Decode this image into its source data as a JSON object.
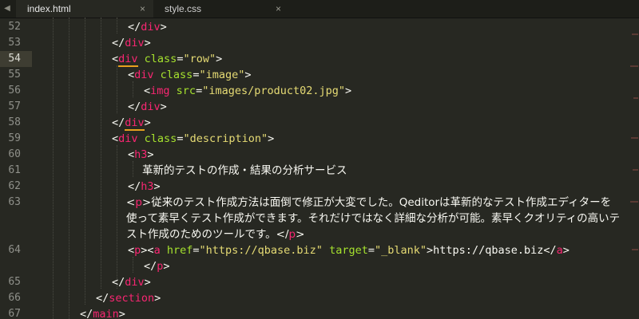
{
  "tabs": [
    {
      "label": "index.html",
      "close": "×"
    },
    {
      "label": "style.css",
      "close": "×"
    }
  ],
  "nav_arrow": "◀",
  "line_numbers": [
    "52",
    "53",
    "54",
    "55",
    "56",
    "57",
    "58",
    "59",
    "60",
    "61",
    "62",
    "63",
    "64",
    "65",
    "66",
    "67"
  ],
  "active_line": "54",
  "code": {
    "l52": {
      "open": "</",
      "tag": "div",
      "close": ">"
    },
    "l53": {
      "open": "</",
      "tag": "div",
      "close": ">"
    },
    "l54": {
      "open": "<",
      "tag": "div",
      "attr": "class",
      "eq": "=",
      "value": "\"row\"",
      "close": ">"
    },
    "l55": {
      "open": "<",
      "tag": "div",
      "attr": "class",
      "eq": "=",
      "value": "\"image\"",
      "close": ">"
    },
    "l56": {
      "open": "<",
      "tag": "img",
      "attr": "src",
      "eq": "=",
      "value": "\"images/product02.jpg\"",
      "close": ">"
    },
    "l57": {
      "open": "</",
      "tag": "div",
      "close": ">"
    },
    "l58": {
      "open": "</",
      "tag": "div",
      "close": ">"
    },
    "l59": {
      "open": "<",
      "tag": "div",
      "attr": "class",
      "eq": "=",
      "value": "\"description\"",
      "close": ">"
    },
    "l60": {
      "open": "<",
      "tag": "h3",
      "close": ">"
    },
    "l61": {
      "text": "革新的テストの作成・結果の分析サービス"
    },
    "l62": {
      "open": "</",
      "tag": "h3",
      "close": ">"
    },
    "l63": {
      "open": "<",
      "tag": "p",
      "close": ">",
      "text": "従来のテスト作成方法は面倒で修正が大変でした。Qeditorは革新的なテスト作成エディターを使って素早くテスト作成ができます。それだけではなく詳細な分析が可能。素早くクオリティの高いテスト作成のためのツールです。",
      "end_open": "</",
      "end_tag": "p",
      "end_close": ">"
    },
    "l64": {
      "open": "<",
      "tag": "p",
      "close": ">",
      "a_open": "<",
      "a_tag": "a",
      "attr1": "href",
      "eq1": "=",
      "value1": "\"https://qbase.biz\"",
      "attr2": "target",
      "eq2": "=",
      "value2": "\"_blank\"",
      "a_close": ">",
      "text": "https://qbase.biz",
      "a_end_open": "</",
      "a_end_tag": "a",
      "a_end_close": ">"
    },
    "l64b": {
      "open": "</",
      "tag": "p",
      "close": ">"
    },
    "l65": {
      "open": "</",
      "tag": "div",
      "close": ">"
    },
    "l66": {
      "open": "</",
      "tag": "section",
      "close": ">"
    },
    "l67": {
      "open": "</",
      "tag": "main",
      "close": ">"
    }
  },
  "colors": {
    "background": "#272822",
    "tag": "#f92672",
    "attribute": "#a6e22e",
    "string": "#e6db74",
    "text": "#f8f8f2",
    "bracket_match": "#e6a01e"
  }
}
